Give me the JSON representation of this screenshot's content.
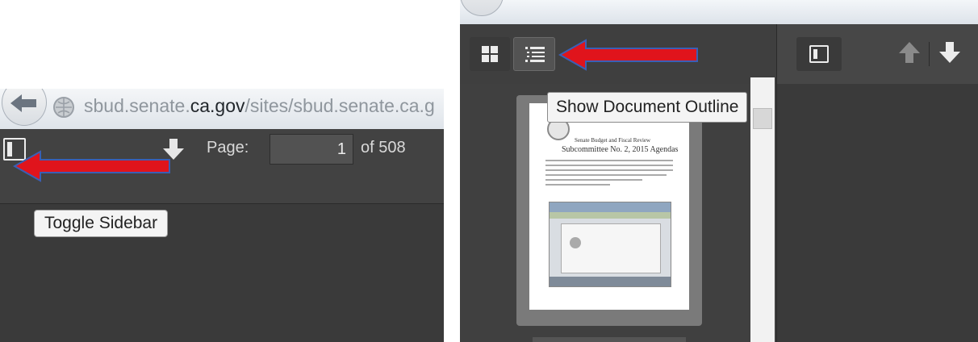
{
  "left_panel": {
    "url_subdomain": "sbud.senate.",
    "url_domain": "ca.gov",
    "url_path": "/sites/sbud.senate.ca.g",
    "page_label": "Page:",
    "page_value": "1",
    "page_total_label": "of 508",
    "tooltip": "Toggle Sidebar"
  },
  "right_panel": {
    "tooltip": "Show Document Outline",
    "doc_header_small": "Senate Budget and Fiscal Review",
    "doc_header_large": "Subcommittee No. 2, 2015 Agendas"
  },
  "annotation_color": "#e0141c",
  "annotation_outline": "#3a5fb5",
  "icons": {
    "back": "back-arrow-icon",
    "site": "globe-icon",
    "toggle": "sidebar-toggle-icon",
    "thumbs": "thumbnails-grid-icon",
    "outline": "document-outline-icon",
    "prev": "up-arrow-icon",
    "next": "down-arrow-icon"
  }
}
